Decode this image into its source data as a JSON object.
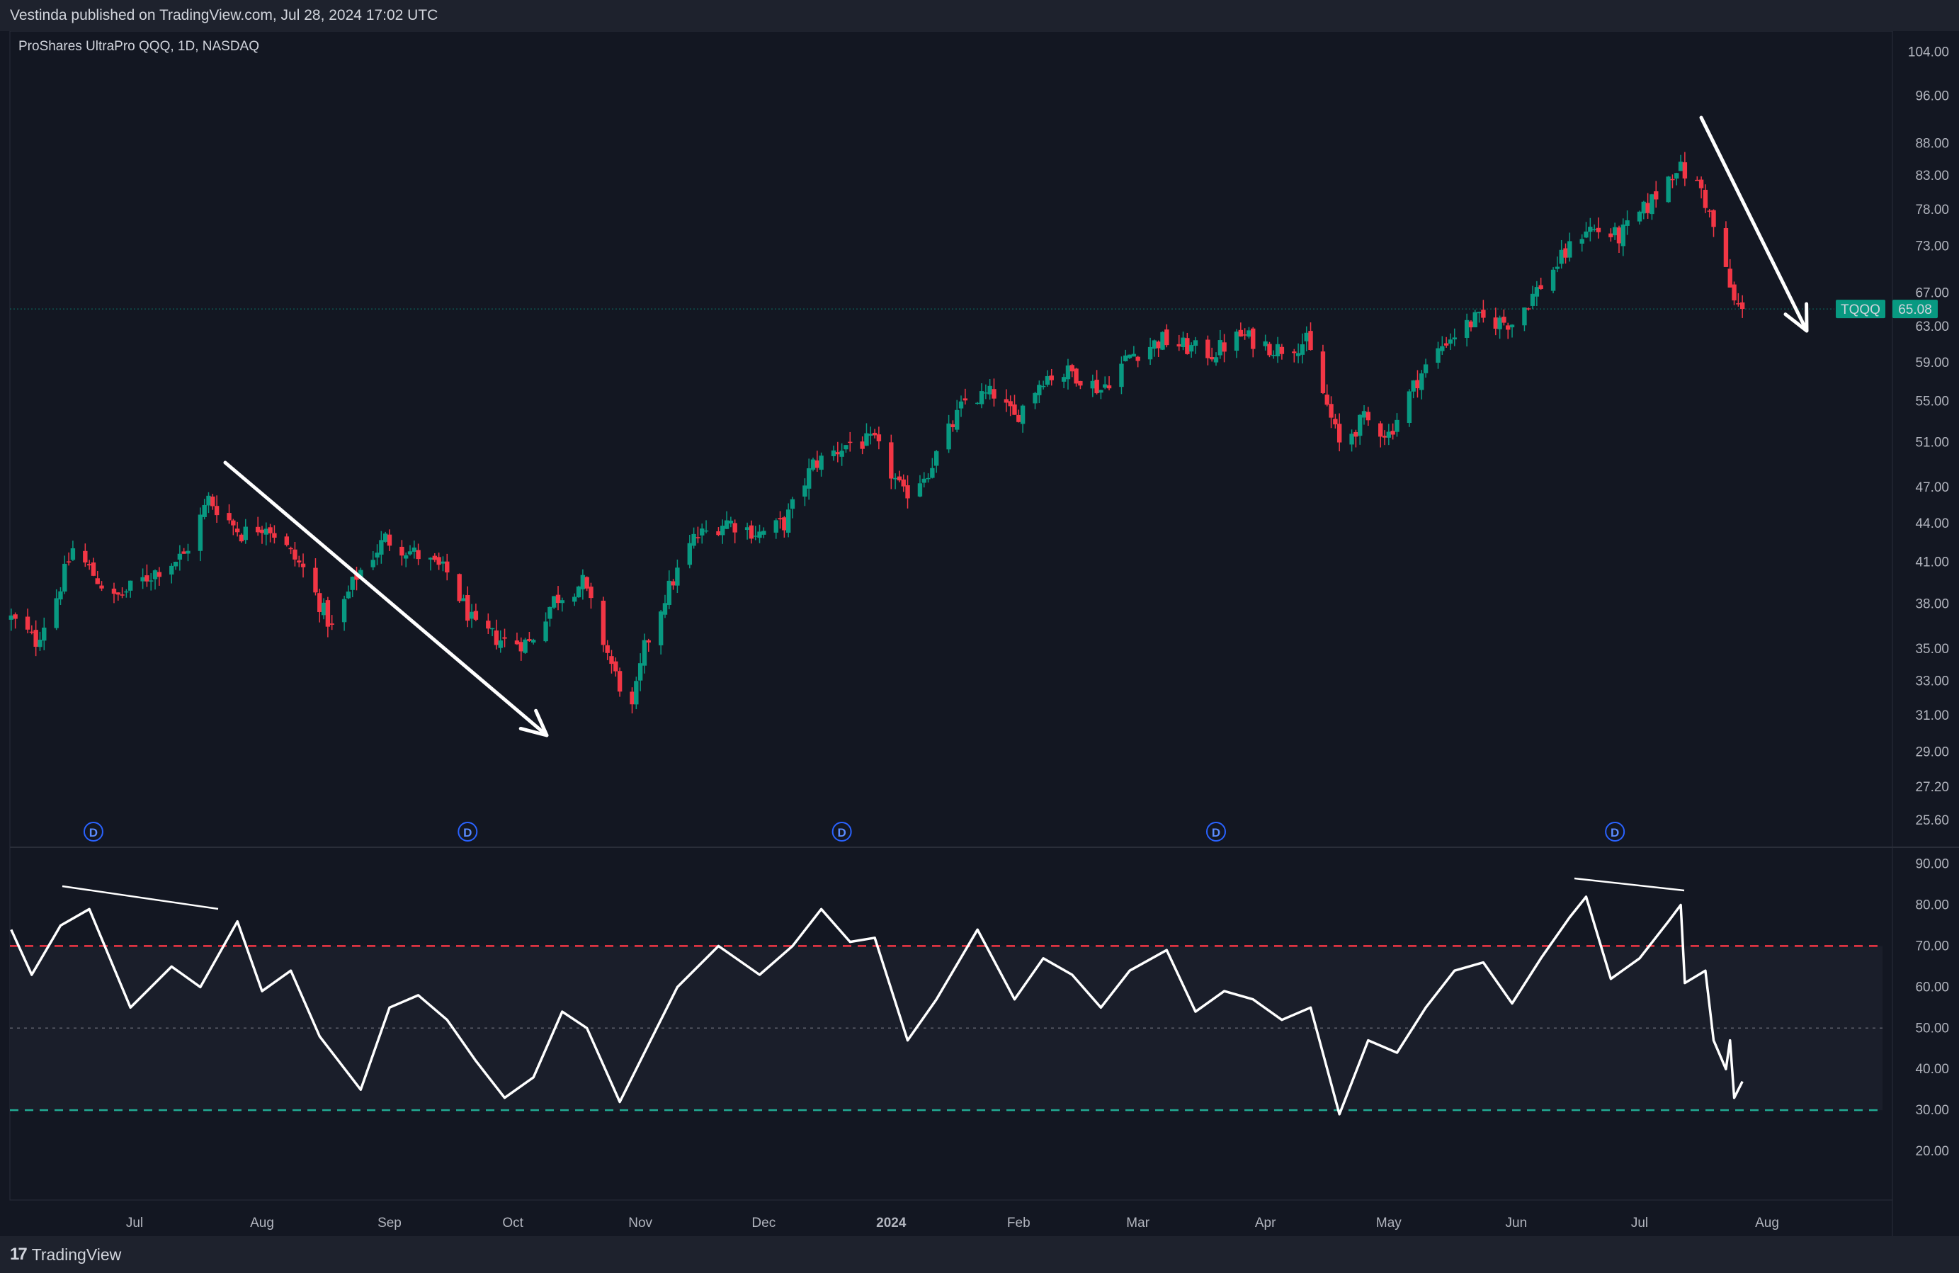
{
  "header": {
    "published": "Vestinda published on TradingView.com, Jul 28, 2024 17:02 UTC"
  },
  "footer": {
    "brand": "TradingView",
    "logo_icon": "tradingview-logo-icon"
  },
  "colors": {
    "background": "#131722",
    "up_candle": "#089981",
    "down_candle": "#f23645",
    "rsi_line": "#ffffff",
    "overbought_line": "#f23645",
    "oversold_line": "#22ab94",
    "price_tag": "#089981"
  },
  "chart_data": [
    {
      "type": "candlestick",
      "symbol_title": "ProShares UltraPro QQQ, 1D, NASDAQ",
      "ticker": "TQQQ",
      "last_price": "65.08",
      "y_scale": "log",
      "ylim": [
        24.5,
        105
      ],
      "y_ticks": [
        "104.00",
        "96.00",
        "88.00",
        "83.00",
        "78.00",
        "73.00",
        "67.00",
        "63.00",
        "59.00",
        "55.00",
        "51.00",
        "47.00",
        "44.00",
        "41.00",
        "38.00",
        "35.00",
        "33.00",
        "31.00",
        "29.00",
        "27.20",
        "25.60"
      ],
      "x_ticks": [
        "Jul",
        "Aug",
        "Sep",
        "Oct",
        "Nov",
        "Dec",
        "2024",
        "Feb",
        "Mar",
        "Apr",
        "May",
        "Jun",
        "Jul",
        "Aug"
      ],
      "x_tick_dates": [
        "2023-07-01",
        "2023-08-01",
        "2023-09-01",
        "2023-10-01",
        "2023-11-01",
        "2023-12-01",
        "2024-01-01",
        "2024-02-01",
        "2024-03-01",
        "2024-04-01",
        "2024-05-01",
        "2024-06-01",
        "2024-07-01",
        "2024-08-01"
      ],
      "date_range": [
        "2023-06-01",
        "2024-08-17"
      ],
      "dividend_markers": {
        "label": "D",
        "dates": [
          "2023-06-21",
          "2023-09-20",
          "2023-12-20",
          "2024-03-20",
          "2024-06-25"
        ]
      },
      "close_keypoints": [
        {
          "date": "2023-06-01",
          "close": 37.0
        },
        {
          "date": "2023-06-07",
          "close": 35.5
        },
        {
          "date": "2023-06-12",
          "close": 38.5
        },
        {
          "date": "2023-06-16",
          "close": 42.0
        },
        {
          "date": "2023-06-26",
          "close": 38.3
        },
        {
          "date": "2023-07-07",
          "close": 40.5
        },
        {
          "date": "2023-07-13",
          "close": 41.5
        },
        {
          "date": "2023-07-19",
          "close": 46.0
        },
        {
          "date": "2023-07-27",
          "close": 43.2
        },
        {
          "date": "2023-08-02",
          "close": 44.0
        },
        {
          "date": "2023-08-11",
          "close": 40.5
        },
        {
          "date": "2023-08-18",
          "close": 36.3
        },
        {
          "date": "2023-08-24",
          "close": 40.0
        },
        {
          "date": "2023-08-31",
          "close": 42.8
        },
        {
          "date": "2023-09-08",
          "close": 41.5
        },
        {
          "date": "2023-09-15",
          "close": 40.2
        },
        {
          "date": "2023-09-22",
          "close": 36.3
        },
        {
          "date": "2023-09-29",
          "close": 35.5
        },
        {
          "date": "2023-10-05",
          "close": 35.4
        },
        {
          "date": "2023-10-11",
          "close": 38.3
        },
        {
          "date": "2023-10-18",
          "close": 39.5
        },
        {
          "date": "2023-10-26",
          "close": 33.3
        },
        {
          "date": "2023-10-30",
          "close": 31.3
        },
        {
          "date": "2023-11-02",
          "close": 35.0
        },
        {
          "date": "2023-11-07",
          "close": 38.5
        },
        {
          "date": "2023-11-14",
          "close": 42.8
        },
        {
          "date": "2023-11-22",
          "close": 44.2
        },
        {
          "date": "2023-11-30",
          "close": 43.2
        },
        {
          "date": "2023-12-06",
          "close": 44.0
        },
        {
          "date": "2023-12-13",
          "close": 49.0
        },
        {
          "date": "2023-12-22",
          "close": 51.0
        },
        {
          "date": "2023-12-28",
          "close": 51.0
        },
        {
          "date": "2024-01-04",
          "close": 46.3
        },
        {
          "date": "2024-01-10",
          "close": 48.5
        },
        {
          "date": "2024-01-19",
          "close": 55.0
        },
        {
          "date": "2024-01-26",
          "close": 55.8
        },
        {
          "date": "2024-01-31",
          "close": 53.3
        },
        {
          "date": "2024-02-07",
          "close": 57.5
        },
        {
          "date": "2024-02-14",
          "close": 58.0
        },
        {
          "date": "2024-02-21",
          "close": 56.2
        },
        {
          "date": "2024-02-28",
          "close": 59.8
        },
        {
          "date": "2024-03-07",
          "close": 61.5
        },
        {
          "date": "2024-03-12",
          "close": 60.8
        },
        {
          "date": "2024-03-19",
          "close": 60.0
        },
        {
          "date": "2024-03-26",
          "close": 62.0
        },
        {
          "date": "2024-04-04",
          "close": 60.5
        },
        {
          "date": "2024-04-11",
          "close": 61.3
        },
        {
          "date": "2024-04-19",
          "close": 50.8
        },
        {
          "date": "2024-04-25",
          "close": 53.2
        },
        {
          "date": "2024-05-01",
          "close": 51.8
        },
        {
          "date": "2024-05-08",
          "close": 57.3
        },
        {
          "date": "2024-05-15",
          "close": 61.5
        },
        {
          "date": "2024-05-22",
          "close": 63.8
        },
        {
          "date": "2024-05-31",
          "close": 63.5
        },
        {
          "date": "2024-06-07",
          "close": 68.0
        },
        {
          "date": "2024-06-18",
          "close": 75.5
        },
        {
          "date": "2024-06-26",
          "close": 74.2
        },
        {
          "date": "2024-07-03",
          "close": 78.5
        },
        {
          "date": "2024-07-10",
          "close": 84.5
        },
        {
          "date": "2024-07-16",
          "close": 81.0
        },
        {
          "date": "2024-07-19",
          "close": 75.5
        },
        {
          "date": "2024-07-24",
          "close": 65.8
        },
        {
          "date": "2024-07-26",
          "close": 65.08
        }
      ]
    },
    {
      "type": "line",
      "indicator": "RSI",
      "ylim": [
        15,
        92
      ],
      "y_ticks": [
        "90.00",
        "80.00",
        "70.00",
        "60.00",
        "50.00",
        "40.00",
        "30.00",
        "20.00"
      ],
      "overbought": 70,
      "oversold": 30,
      "midline": 50,
      "points": [
        {
          "date": "2023-06-01",
          "value": 74
        },
        {
          "date": "2023-06-06",
          "value": 63
        },
        {
          "date": "2023-06-13",
          "value": 75
        },
        {
          "date": "2023-06-20",
          "value": 79
        },
        {
          "date": "2023-06-30",
          "value": 55
        },
        {
          "date": "2023-07-10",
          "value": 65
        },
        {
          "date": "2023-07-17",
          "value": 60
        },
        {
          "date": "2023-07-26",
          "value": 76
        },
        {
          "date": "2023-08-01",
          "value": 59
        },
        {
          "date": "2023-08-08",
          "value": 64
        },
        {
          "date": "2023-08-15",
          "value": 48
        },
        {
          "date": "2023-08-25",
          "value": 35
        },
        {
          "date": "2023-09-01",
          "value": 55
        },
        {
          "date": "2023-09-08",
          "value": 58
        },
        {
          "date": "2023-09-15",
          "value": 52
        },
        {
          "date": "2023-09-22",
          "value": 42
        },
        {
          "date": "2023-09-29",
          "value": 33
        },
        {
          "date": "2023-10-06",
          "value": 38
        },
        {
          "date": "2023-10-13",
          "value": 54
        },
        {
          "date": "2023-10-19",
          "value": 50
        },
        {
          "date": "2023-10-27",
          "value": 32
        },
        {
          "date": "2023-11-02",
          "value": 44
        },
        {
          "date": "2023-11-10",
          "value": 60
        },
        {
          "date": "2023-11-20",
          "value": 70
        },
        {
          "date": "2023-11-30",
          "value": 63
        },
        {
          "date": "2023-12-08",
          "value": 70
        },
        {
          "date": "2023-12-15",
          "value": 79
        },
        {
          "date": "2023-12-22",
          "value": 71
        },
        {
          "date": "2023-12-28",
          "value": 72
        },
        {
          "date": "2024-01-05",
          "value": 47
        },
        {
          "date": "2024-01-12",
          "value": 57
        },
        {
          "date": "2024-01-22",
          "value": 74
        },
        {
          "date": "2024-01-31",
          "value": 57
        },
        {
          "date": "2024-02-07",
          "value": 67
        },
        {
          "date": "2024-02-14",
          "value": 63
        },
        {
          "date": "2024-02-21",
          "value": 55
        },
        {
          "date": "2024-02-28",
          "value": 64
        },
        {
          "date": "2024-03-08",
          "value": 69
        },
        {
          "date": "2024-03-15",
          "value": 54
        },
        {
          "date": "2024-03-22",
          "value": 59
        },
        {
          "date": "2024-03-29",
          "value": 57
        },
        {
          "date": "2024-04-05",
          "value": 52
        },
        {
          "date": "2024-04-12",
          "value": 55
        },
        {
          "date": "2024-04-19",
          "value": 29
        },
        {
          "date": "2024-04-26",
          "value": 47
        },
        {
          "date": "2024-05-03",
          "value": 44
        },
        {
          "date": "2024-05-10",
          "value": 55
        },
        {
          "date": "2024-05-17",
          "value": 64
        },
        {
          "date": "2024-05-24",
          "value": 66
        },
        {
          "date": "2024-05-31",
          "value": 56
        },
        {
          "date": "2024-06-07",
          "value": 67
        },
        {
          "date": "2024-06-14",
          "value": 77
        },
        {
          "date": "2024-06-18",
          "value": 82
        },
        {
          "date": "2024-06-24",
          "value": 62
        },
        {
          "date": "2024-07-01",
          "value": 67
        },
        {
          "date": "2024-07-08",
          "value": 76
        },
        {
          "date": "2024-07-11",
          "value": 80
        },
        {
          "date": "2024-07-12",
          "value": 61
        },
        {
          "date": "2024-07-17",
          "value": 64
        },
        {
          "date": "2024-07-19",
          "value": 47
        },
        {
          "date": "2024-07-22",
          "value": 40
        },
        {
          "date": "2024-07-23",
          "value": 47
        },
        {
          "date": "2024-07-24",
          "value": 33
        },
        {
          "date": "2024-07-26",
          "value": 37
        }
      ]
    }
  ]
}
